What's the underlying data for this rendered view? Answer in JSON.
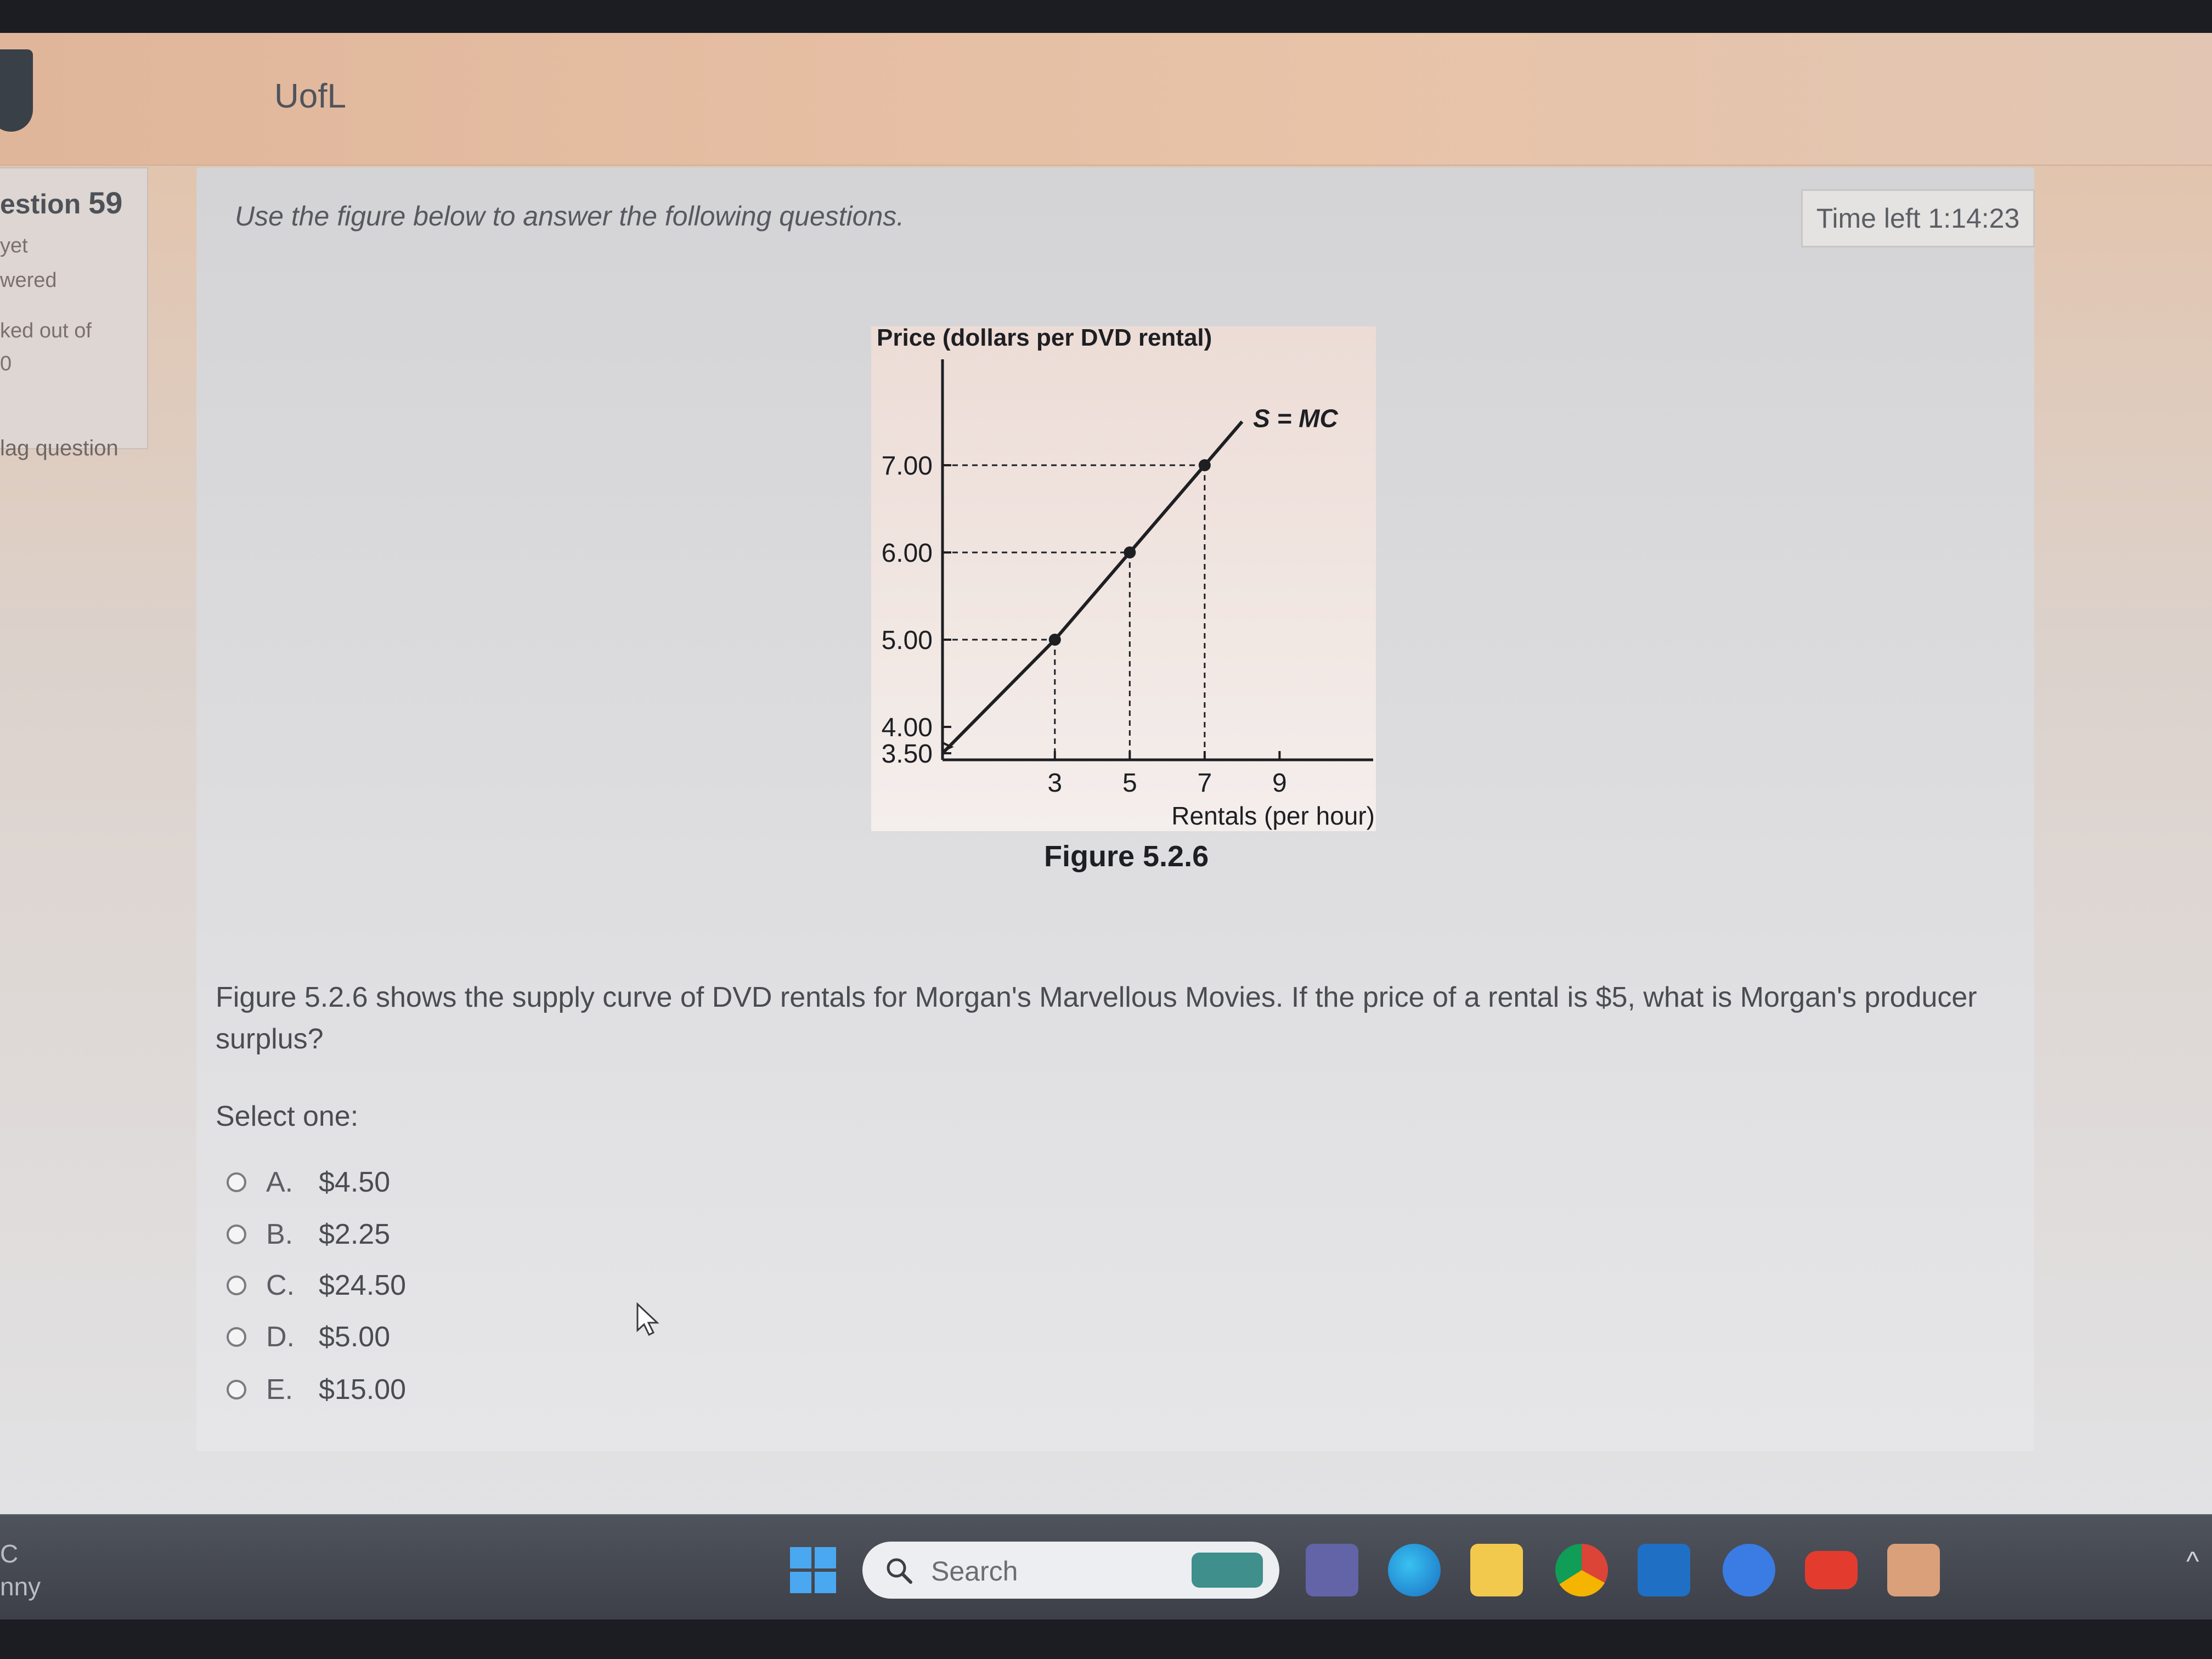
{
  "header": {
    "site_name": "UofL"
  },
  "sidebar": {
    "question_word": "estion",
    "question_number": "59",
    "status_line1": "yet",
    "status_line2": "wered",
    "marks_line1": "ked out of",
    "marks_line2": "0",
    "flag_label": "lag question"
  },
  "content": {
    "instructions": "Use the figure below to answer the following questions.",
    "timer": "Time left 1:14:23",
    "figure_caption": "Figure 5.2.6",
    "question": "Figure 5.2.6 shows the supply curve of DVD rentals for Morgan's Marvellous Movies. If the price of a rental is $5, what is Morgan's producer surplus?",
    "select_label": "Select one:",
    "options": [
      {
        "letter": "A.",
        "value": "$4.50"
      },
      {
        "letter": "B.",
        "value": "$2.25"
      },
      {
        "letter": "C.",
        "value": "$24.50"
      },
      {
        "letter": "D.",
        "value": "$5.00"
      },
      {
        "letter": "E.",
        "value": "$15.00"
      }
    ]
  },
  "chart_data": {
    "type": "line",
    "ylabel": "Price (dollars per DVD rental)",
    "xlabel": "Rentals (per hour)",
    "curve_label": "S = MC",
    "y_ticks": [
      "7.00",
      "6.00",
      "5.00",
      "4.00",
      "3.50"
    ],
    "y_tick_values": [
      7.0,
      6.0,
      5.0,
      4.0,
      3.5
    ],
    "x_ticks": [
      "3",
      "5",
      "7",
      "9"
    ],
    "x_tick_values": [
      3,
      5,
      7,
      9
    ],
    "series": [
      {
        "x": [
          0,
          3,
          5,
          7,
          8
        ],
        "y": [
          3.5,
          5.0,
          6.0,
          7.0,
          7.5
        ]
      }
    ],
    "marked_points": [
      {
        "x": 3,
        "y": 5.0
      },
      {
        "x": 5,
        "y": 6.0
      },
      {
        "x": 7,
        "y": 7.0
      }
    ],
    "xlim": [
      0,
      11.5
    ],
    "ylim_note": "y axis scale breaks below 4.00",
    "colors": {
      "line": "#1d1f23",
      "background": "#f1e7e3"
    }
  },
  "taskbar": {
    "left_line1": "C",
    "left_line2": "nny",
    "search_placeholder": "Search",
    "icons": [
      "windows-start-icon",
      "teams-icon",
      "edge-icon",
      "file-explorer-icon",
      "chrome-icon",
      "outlook-icon",
      "facebook-icon",
      "youtube-icon",
      "app-icon"
    ]
  }
}
